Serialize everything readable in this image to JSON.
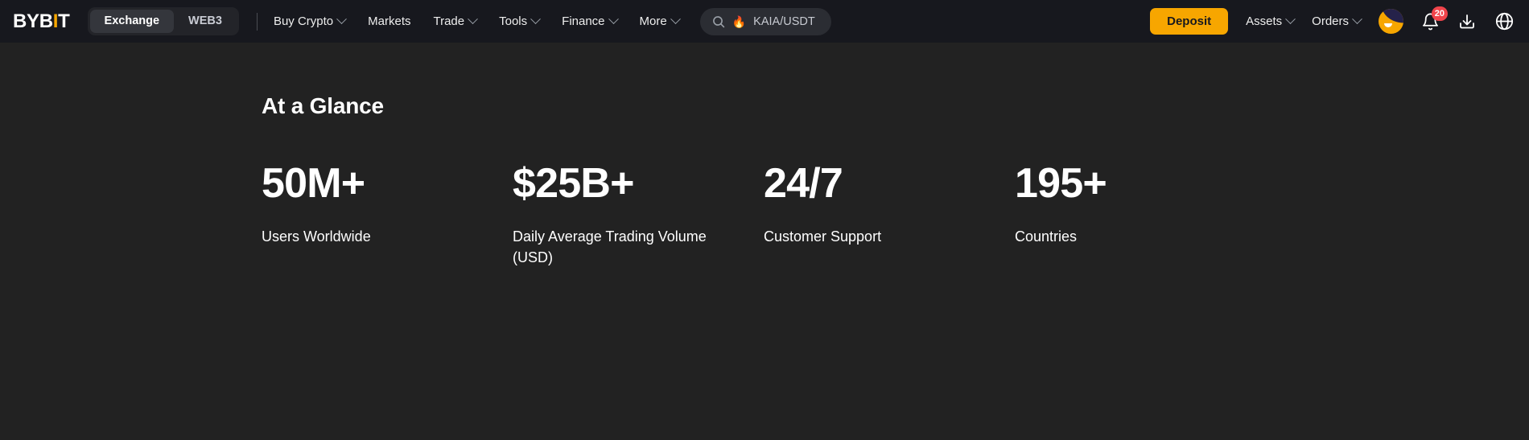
{
  "header": {
    "logo": {
      "prefix": "BYB",
      "accent": "I",
      "suffix": "T"
    },
    "segments": [
      {
        "label": "Exchange",
        "active": true
      },
      {
        "label": "WEB3",
        "active": false
      }
    ],
    "nav": [
      {
        "label": "Buy Crypto",
        "caret": true
      },
      {
        "label": "Markets",
        "caret": false
      },
      {
        "label": "Trade",
        "caret": true
      },
      {
        "label": "Tools",
        "caret": true
      },
      {
        "label": "Finance",
        "caret": true
      },
      {
        "label": "More",
        "caret": true
      }
    ],
    "search": {
      "icon": "search-icon",
      "flame": "🔥",
      "value": "KAIA/USDT"
    },
    "deposit_label": "Deposit",
    "account_links": [
      {
        "label": "Assets",
        "caret": true
      },
      {
        "label": "Orders",
        "caret": true
      }
    ],
    "notification_count": "20",
    "icons": [
      "avatar",
      "bell-icon",
      "download-icon",
      "globe-icon"
    ],
    "colors": {
      "bar_bg": "#17181E",
      "accent": "#F7A600",
      "badge": "#F0444B",
      "page_bg": "#222222"
    }
  },
  "main": {
    "title": "At a Glance",
    "stats": [
      {
        "value": "50M+",
        "label": "Users Worldwide"
      },
      {
        "value": "$25B+",
        "label": "Daily Average Trading Volume (USD)"
      },
      {
        "value": "24/7",
        "label": "Customer Support"
      },
      {
        "value": "195+",
        "label": "Countries"
      }
    ]
  }
}
